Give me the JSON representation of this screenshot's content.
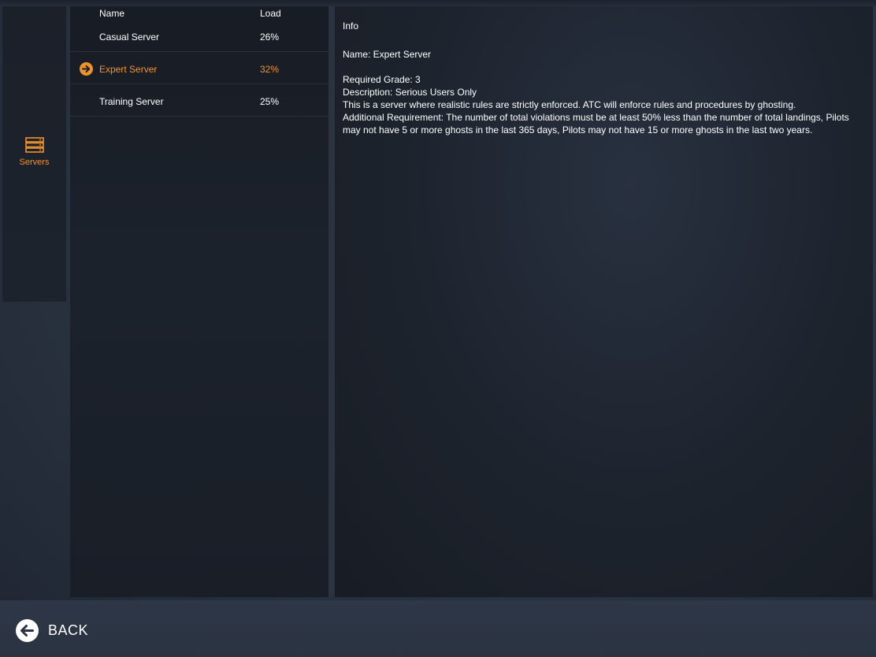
{
  "sidebar": {
    "items": [
      {
        "label": "Servers",
        "icon": "server-stack-icon",
        "active": true
      }
    ]
  },
  "server_list": {
    "columns": {
      "name": "Name",
      "load": "Load"
    },
    "rows": [
      {
        "name": "Casual Server",
        "load": "26%",
        "selected": false
      },
      {
        "name": "Expert Server",
        "load": "32%",
        "selected": true
      },
      {
        "name": "Training Server",
        "load": "25%",
        "selected": false
      }
    ]
  },
  "info": {
    "title": "Info",
    "name_line": "Name: Expert Server",
    "grade_line": "Required Grade: 3",
    "description_line": "Description: Serious Users Only",
    "rules_line": "This is a server where realistic rules are strictly enforced. ATC will enforce rules and procedures by ghosting.",
    "requirement_line": "Additional Requirement: The number of total violations must be at least 50% less than the number of total landings, Pilots may not have 5 or more ghosts in the last 365 days, Pilots may not have 15 or more ghosts in the last two years."
  },
  "footer": {
    "back_label": "BACK"
  },
  "colors": {
    "accent": "#f0922c",
    "text": "#ffffff",
    "panel": "#1b2029",
    "background": "#2a3341"
  }
}
